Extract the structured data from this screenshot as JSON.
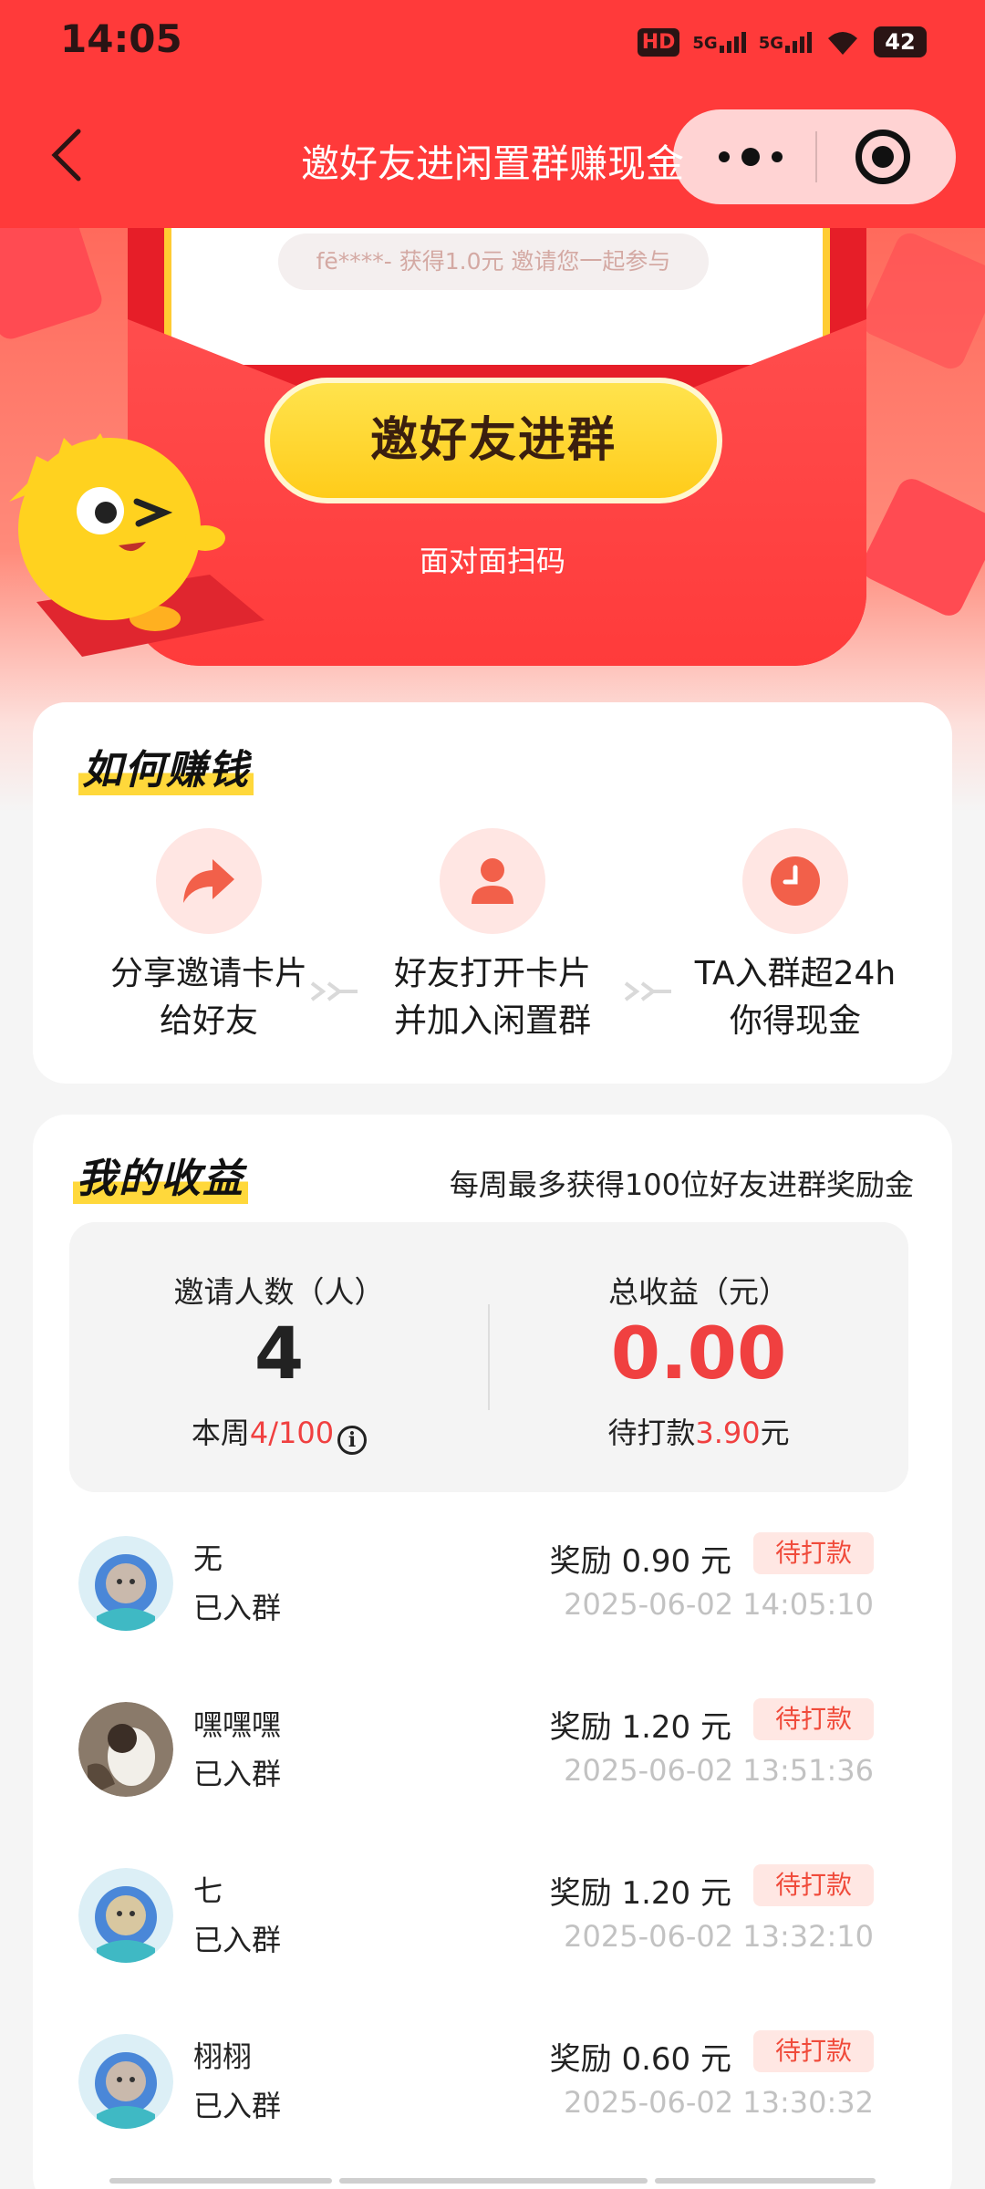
{
  "status_bar": {
    "time": "14:05",
    "hd_label": "HD",
    "net1_label": "5G",
    "net2_label": "5G",
    "battery": "42"
  },
  "nav": {
    "title": "邀好友进闲置群赚现金"
  },
  "hero": {
    "ticker": "fē****- 获得1.0元 邀请您一起参与",
    "cta": "邀好友进群",
    "face_to_face": "面对面扫码"
  },
  "howto": {
    "title": "如何赚钱",
    "steps": [
      {
        "icon": "share-arrow-icon",
        "line1": "分享邀请卡片",
        "line2": "给好友"
      },
      {
        "icon": "person-icon",
        "line1": "好友打开卡片",
        "line2": "并加入闲置群"
      },
      {
        "icon": "clock-icon",
        "line1": "TA入群超24h",
        "line2": "你得现金"
      }
    ]
  },
  "earnings": {
    "title": "我的收益",
    "hint": "每周最多获得100位好友进群奖励金",
    "invited_label": "邀请人数（人）",
    "invited_count": "4",
    "week_prefix": "本周",
    "week_value": "4/100",
    "total_label": "总收益（元）",
    "total_value": "0.00",
    "pending_prefix": "待打款",
    "pending_value": "3.90",
    "pending_suffix": "元"
  },
  "records": [
    {
      "name": "无",
      "state": "已入群",
      "reward": "奖励 0.90 元",
      "badge": "待打款",
      "time": "2025-06-02 14:05:10",
      "avatar": "cat-avatar"
    },
    {
      "name": "嘿嘿嘿",
      "state": "已入群",
      "reward": "奖励 1.20 元",
      "badge": "待打款",
      "time": "2025-06-02 13:51:36",
      "avatar": "photo-avatar"
    },
    {
      "name": "七",
      "state": "已入群",
      "reward": "奖励 1.20 元",
      "badge": "待打款",
      "time": "2025-06-02 13:32:10",
      "avatar": "cat-avatar"
    },
    {
      "name": "栩栩",
      "state": "已入群",
      "reward": "奖励 0.60 元",
      "badge": "待打款",
      "time": "2025-06-02 13:30:32",
      "avatar": "cat-avatar"
    }
  ],
  "colors": {
    "brand_red": "#ff3a3a",
    "accent_red": "#f04040",
    "cta_yellow": "#ffcc1a"
  }
}
